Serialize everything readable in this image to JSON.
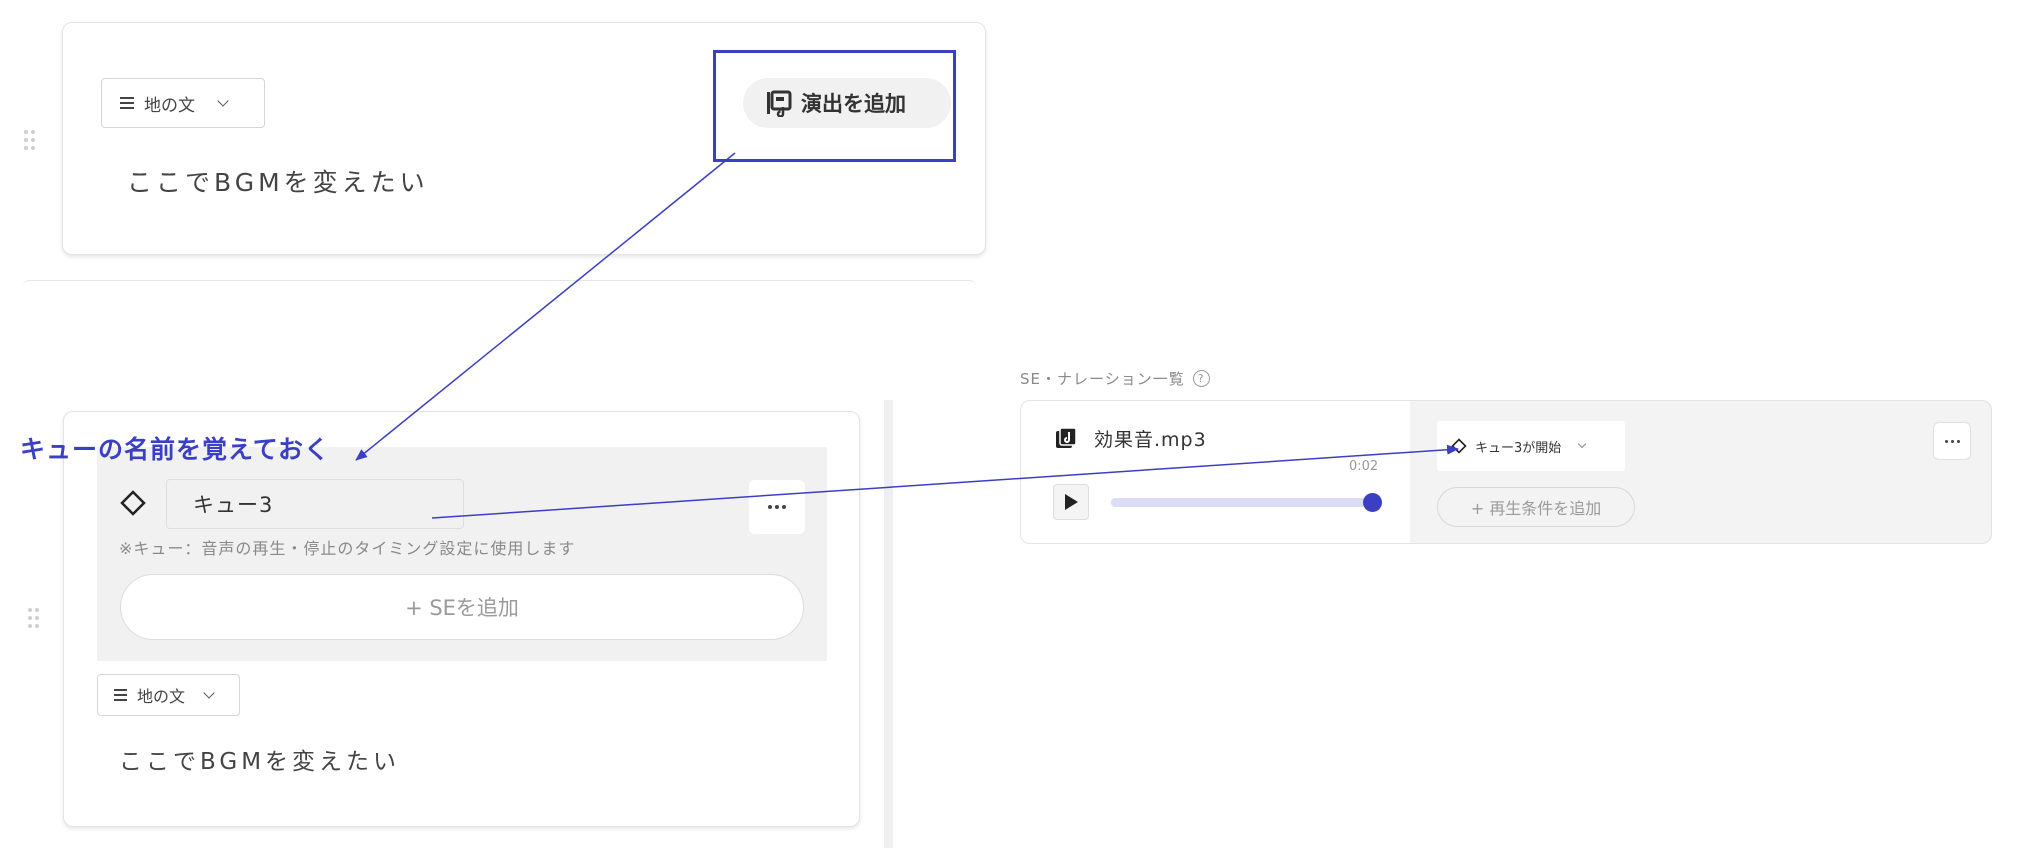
{
  "top_card": {
    "type_select_label": "地の文",
    "add_effect_label": "演出を追加",
    "body_text": "ここでBGMを変えたい"
  },
  "annotation": {
    "label": "キューの名前を覚えておく",
    "accent": "#3b3fc4"
  },
  "bottom_card": {
    "cue_name_value": "キュー3",
    "cue_note": "※キュー：音声の再生・停止のタイミング設定に使用します",
    "add_se_label": "+ SEを追加",
    "type_select_label": "地の文",
    "body_text": "ここでBGMを変えたい"
  },
  "se_panel": {
    "heading": "SE・ナレーション一覧",
    "file_name": "効果音.mp3",
    "time": "0:02",
    "progress": 1.0,
    "condition_label": "キュー3が開始",
    "add_condition_label": "+ 再生条件を追加"
  },
  "colors": {
    "accent": "#3b3fc4",
    "slider_track": "#dcdcf5",
    "slider_thumb": "#3b3fc4",
    "panel_bg": "#f1f1f1"
  }
}
